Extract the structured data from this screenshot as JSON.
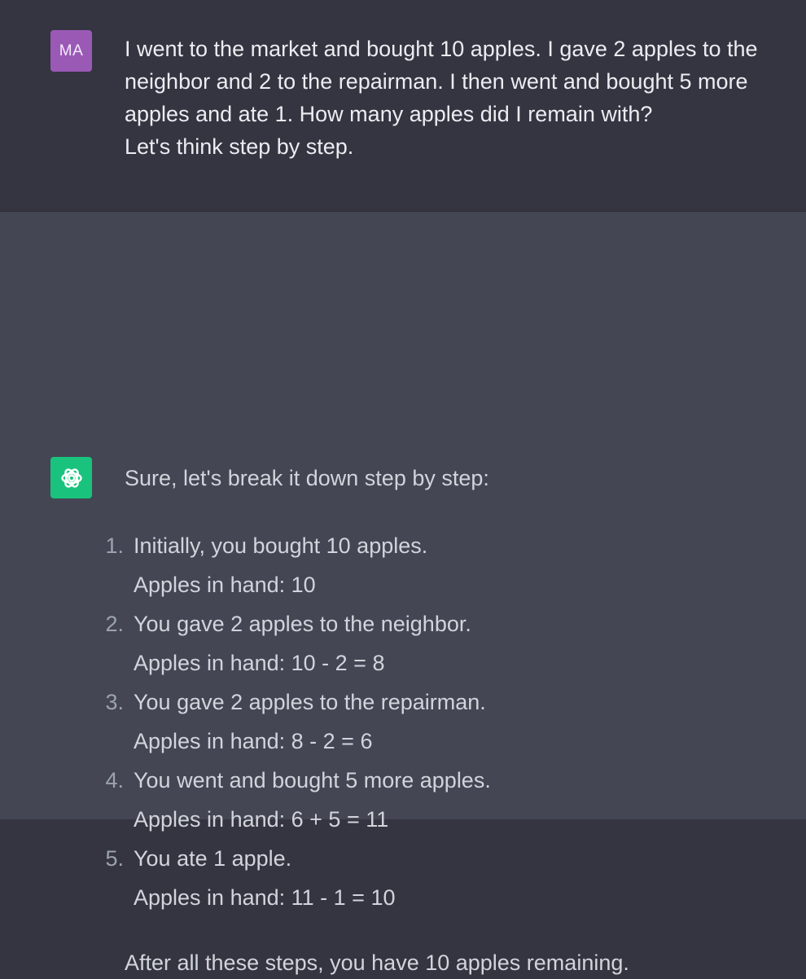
{
  "colors": {
    "page_bg": "#343541",
    "assistant_bg": "#444654",
    "user_avatar_bg": "#9b59b6",
    "assistant_avatar_bg": "#19c37d",
    "text_primary": "#ececf1",
    "text_secondary": "#d1d5db",
    "text_muted": "#9ca3af"
  },
  "user_message": {
    "avatar_initials": "MA",
    "text": "I went to the market and bought 10 apples. I gave 2 apples to the neighbor and 2 to the repairman. I then went and bought 5 more apples and ate 1. How many apples did I remain with?\nLet's think step by step."
  },
  "assistant_message": {
    "avatar_icon": "openai-logo-icon",
    "intro": "Sure, let's break it down step by step:",
    "steps": [
      {
        "number": "1.",
        "text": "Initially, you bought 10 apples.",
        "detail": "Apples in hand: 10"
      },
      {
        "number": "2.",
        "text": "You gave 2 apples to the neighbor.",
        "detail": "Apples in hand: 10 - 2 = 8"
      },
      {
        "number": "3.",
        "text": "You gave 2 apples to the repairman.",
        "detail": "Apples in hand: 8 - 2 = 6"
      },
      {
        "number": "4.",
        "text": "You went and bought 5 more apples.",
        "detail": "Apples in hand: 6 + 5 = 11"
      },
      {
        "number": "5.",
        "text": "You ate 1 apple.",
        "detail": "Apples in hand: 11 - 1 = 10"
      }
    ],
    "outro": "After all these steps, you have 10 apples remaining."
  }
}
